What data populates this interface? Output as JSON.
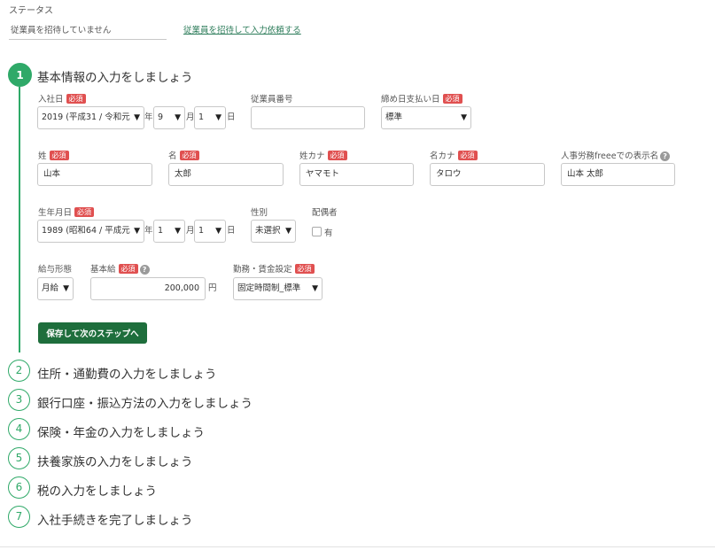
{
  "status": {
    "label": "ステータス",
    "value": "従業員を招待していません",
    "invite_link": "従業員を招待して入力依頼する"
  },
  "required_badge": "必須",
  "help_icon": "help-icon",
  "accent_color": "#2fa968",
  "step1": {
    "number": "1",
    "title": "基本情報の入力をしましょう",
    "join_date": {
      "label": "入社日",
      "year": "2019 (平成31 / 令和元",
      "year_unit": "年",
      "month": "9",
      "month_unit": "月",
      "day": "1",
      "day_unit": "日"
    },
    "employee_number": {
      "label": "従業員番号",
      "value": ""
    },
    "closing_payday": {
      "label": "締め日支払い日",
      "value": "標準"
    },
    "last_name": {
      "label": "姓",
      "value": "山本"
    },
    "first_name": {
      "label": "名",
      "value": "太郎"
    },
    "last_name_kana": {
      "label": "姓カナ",
      "value": "ヤマモト"
    },
    "first_name_kana": {
      "label": "名カナ",
      "value": "タロウ"
    },
    "display_name": {
      "label": "人事労務freeeでの表示名",
      "value": "山本 太郎"
    },
    "birth_date": {
      "label": "生年月日",
      "year": "1989 (昭和64 / 平成元",
      "year_unit": "年",
      "month": "1",
      "month_unit": "月",
      "day": "1",
      "day_unit": "日"
    },
    "gender": {
      "label": "性別",
      "value": "未選択"
    },
    "spouse": {
      "label": "配偶者",
      "checkbox_label": "有"
    },
    "pay_type": {
      "label": "給与形態",
      "value": "月給"
    },
    "base_salary": {
      "label": "基本給",
      "value": "200,000",
      "unit": "円"
    },
    "work_setting": {
      "label": "勤務・賃金設定",
      "value": "固定時間制_標準"
    },
    "save_button": "保存して次のステップへ"
  },
  "steps": [
    {
      "number": "2",
      "title": "住所・通勤費の入力をしましょう"
    },
    {
      "number": "3",
      "title": "銀行口座・振込方法の入力をしましょう"
    },
    {
      "number": "4",
      "title": "保険・年金の入力をしましょう"
    },
    {
      "number": "5",
      "title": "扶養家族の入力をしましょう"
    },
    {
      "number": "6",
      "title": "税の入力をしましょう"
    },
    {
      "number": "7",
      "title": "入社手続きを完了しましょう"
    }
  ]
}
